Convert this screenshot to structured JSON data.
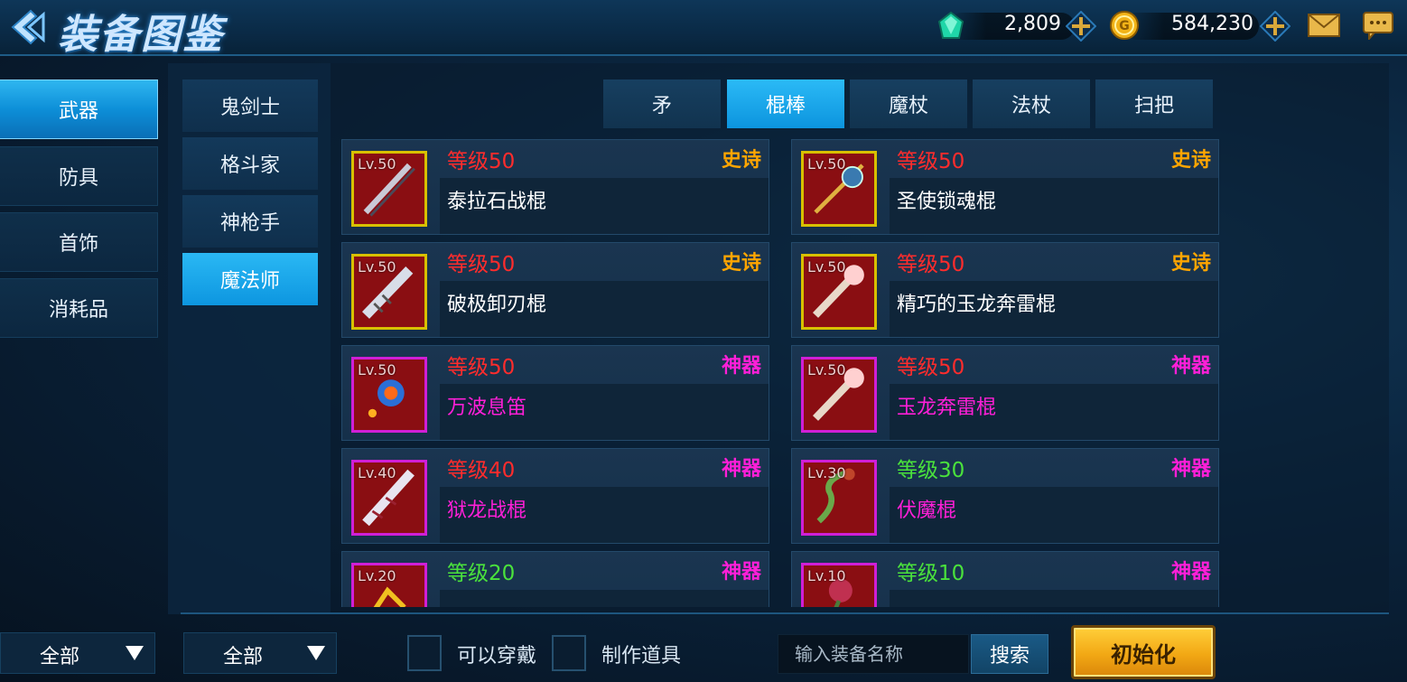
{
  "header": {
    "title": "装备图鉴"
  },
  "currency": {
    "gems": "2,809",
    "gold": "584,230"
  },
  "categories": [
    {
      "label": "武器",
      "active": true
    },
    {
      "label": "防具",
      "active": false
    },
    {
      "label": "首饰",
      "active": false
    },
    {
      "label": "消耗品",
      "active": false
    }
  ],
  "classes": [
    {
      "label": "鬼剑士",
      "active": false
    },
    {
      "label": "格斗家",
      "active": false
    },
    {
      "label": "神枪手",
      "active": false
    },
    {
      "label": "魔法师",
      "active": true
    }
  ],
  "weapon_types": [
    {
      "label": "矛",
      "active": false
    },
    {
      "label": "棍棒",
      "active": true
    },
    {
      "label": "魔杖",
      "active": false
    },
    {
      "label": "法杖",
      "active": false
    },
    {
      "label": "扫把",
      "active": false
    }
  ],
  "items": [
    {
      "lv": "Lv.50",
      "level": "等级50",
      "rarity": "史诗",
      "name": "泰拉石战棍",
      "level_color": "red",
      "rarity_color": "orange",
      "name_color": "white",
      "frame": "gold"
    },
    {
      "lv": "Lv.50",
      "level": "等级50",
      "rarity": "史诗",
      "name": "圣使锁魂棍",
      "level_color": "red",
      "rarity_color": "orange",
      "name_color": "white",
      "frame": "gold"
    },
    {
      "lv": "Lv.50",
      "level": "等级50",
      "rarity": "史诗",
      "name": "破极卸刃棍",
      "level_color": "red",
      "rarity_color": "orange",
      "name_color": "white",
      "frame": "gold"
    },
    {
      "lv": "Lv.50",
      "level": "等级50",
      "rarity": "史诗",
      "name": "精巧的玉龙奔雷棍",
      "level_color": "red",
      "rarity_color": "orange",
      "name_color": "white",
      "frame": "gold"
    },
    {
      "lv": "Lv.50",
      "level": "等级50",
      "rarity": "神器",
      "name": "万波息笛",
      "level_color": "red",
      "rarity_color": "magenta",
      "name_color": "magenta",
      "frame": "purple"
    },
    {
      "lv": "Lv.50",
      "level": "等级50",
      "rarity": "神器",
      "name": "玉龙奔雷棍",
      "level_color": "red",
      "rarity_color": "magenta",
      "name_color": "magenta",
      "frame": "purple"
    },
    {
      "lv": "Lv.40",
      "level": "等级40",
      "rarity": "神器",
      "name": "狱龙战棍",
      "level_color": "red",
      "rarity_color": "magenta",
      "name_color": "magenta",
      "frame": "purple"
    },
    {
      "lv": "Lv.30",
      "level": "等级30",
      "rarity": "神器",
      "name": "伏魔棍",
      "level_color": "green",
      "rarity_color": "magenta",
      "name_color": "magenta",
      "frame": "purple"
    },
    {
      "lv": "Lv.20",
      "level": "等级20",
      "rarity": "神器",
      "name": "",
      "level_color": "green",
      "rarity_color": "magenta",
      "name_color": "magenta",
      "frame": "purple"
    },
    {
      "lv": "Lv.10",
      "level": "等级10",
      "rarity": "神器",
      "name": "",
      "level_color": "green",
      "rarity_color": "magenta",
      "name_color": "magenta",
      "frame": "purple"
    }
  ],
  "filters": {
    "category_filter": "全部",
    "class_filter": "全部",
    "wearable_label": "可以穿戴",
    "craftable_label": "制作道具",
    "search_placeholder": "输入装备名称",
    "search_button": "搜索",
    "reset_button": "初始化"
  }
}
